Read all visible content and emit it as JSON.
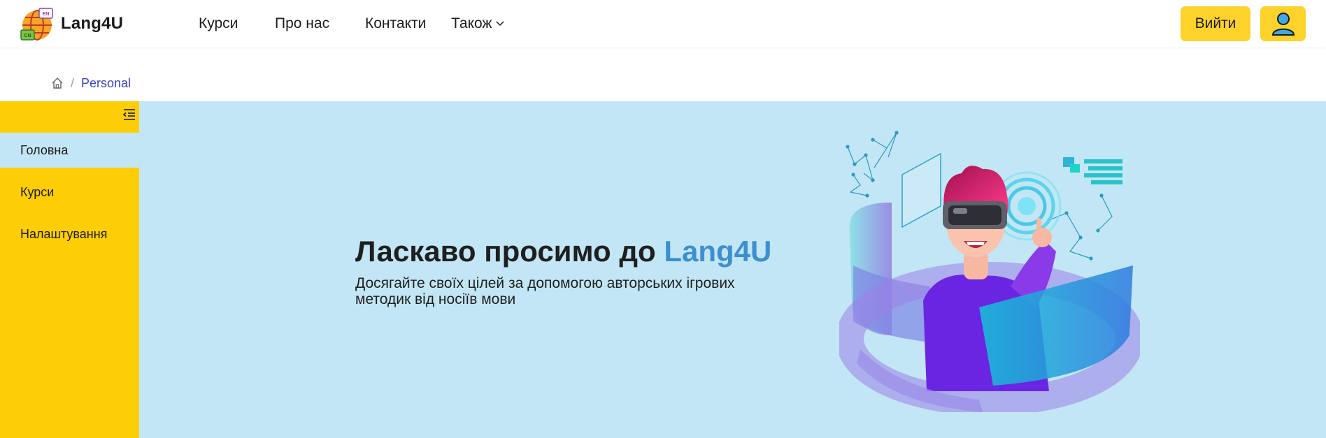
{
  "header": {
    "brand": "Lang4U",
    "logo_tags": {
      "top": "EN",
      "bottom": "CN"
    },
    "nav": [
      "Курси",
      "Про нас",
      "Контакти"
    ],
    "nav_more": "Також",
    "login_label": "Вийти"
  },
  "breadcrumb": {
    "current": "Personal"
  },
  "sidebar": {
    "items": [
      {
        "label": "Головна",
        "active": true
      },
      {
        "label": "Курси",
        "active": false
      },
      {
        "label": "Налаштування",
        "active": false
      }
    ]
  },
  "hero": {
    "title_prefix": "Ласкаво просимо до ",
    "title_accent": "Lang4U",
    "subtitle": "Досягайте своїх цілей за допомогою авторських ігрових методик від носіїв мови"
  },
  "colors": {
    "accent_yellow": "#fdce05",
    "hero_bg": "#c2e6f5",
    "brand_blue": "#3d8fd0",
    "breadcrumb_link": "#3b43c9"
  },
  "icons": [
    "globe-logo-icon",
    "chevron-down-icon",
    "user-icon",
    "home-icon",
    "sidebar-collapse-icon"
  ]
}
